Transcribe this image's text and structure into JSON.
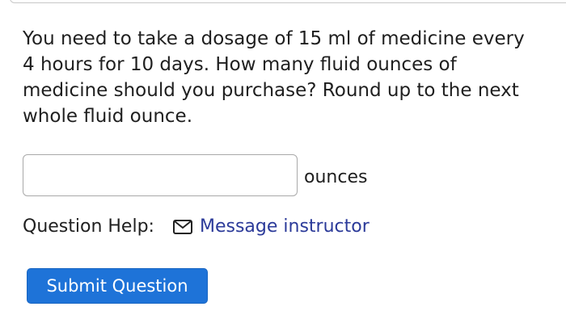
{
  "question": {
    "text": "You need to take a dosage of 15 ml of medicine every 4 hours for 10 days. How many fluid ounces of medicine should you purchase? Round up to the next whole fluid ounce."
  },
  "answer": {
    "value": "",
    "unit_label": "ounces"
  },
  "help": {
    "label": "Question Help:",
    "icon": "mail-icon",
    "message_link": "Message instructor"
  },
  "submit": {
    "label": "Submit Question"
  },
  "colors": {
    "link": "#2b3a99",
    "submit_bg": "#1e73d8",
    "submit_text": "#ffffff"
  }
}
